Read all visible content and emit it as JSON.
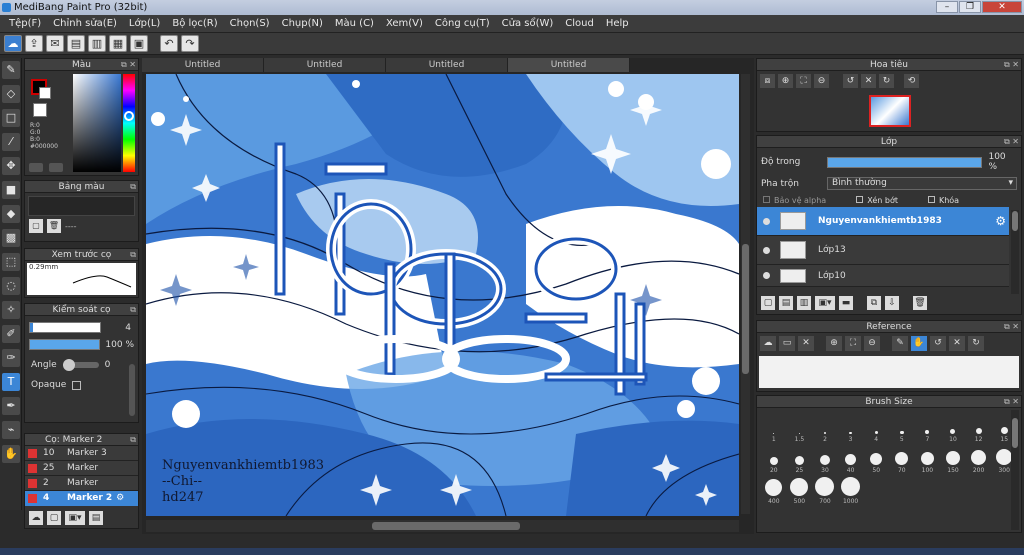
{
  "window": {
    "title": "MediBang Paint Pro (32bit)"
  },
  "menu": [
    "Tệp(F)",
    "Chỉnh sửa(E)",
    "Lớp(L)",
    "Bộ lọc(R)",
    "Chọn(S)",
    "Chụp(N)",
    "Màu (C)",
    "Xem(V)",
    "Công cụ(T)",
    "Cửa sổ(W)",
    "Cloud",
    "Help"
  ],
  "tabs": [
    "Untitled",
    "Untitled",
    "Untitled",
    "Untitled"
  ],
  "color_panel": {
    "title": "Màu",
    "r": "R:0",
    "g": "G:0",
    "b": "B:0",
    "hex": "#000000"
  },
  "palette_panel": {
    "title": "Bảng màu",
    "value": "----"
  },
  "preview_panel": {
    "title": "Xem trước cọ",
    "size": "0.29mm"
  },
  "control_panel": {
    "title": "Kiểm soát cọ",
    "size_value": "4",
    "opacity_value": "100 %",
    "angle_label": "Angle",
    "angle_value": "0",
    "opaque_label": "Opaque"
  },
  "brush_panel": {
    "title": "Cọ: Marker 2",
    "items": [
      {
        "size": "10",
        "name": "Marker 3"
      },
      {
        "size": "25",
        "name": "Marker"
      },
      {
        "size": "2",
        "name": "Marker"
      },
      {
        "size": "4",
        "name": "Marker 2"
      }
    ]
  },
  "navigator": {
    "title": "Hoa tiêu"
  },
  "layer_panel": {
    "title": "Lớp",
    "opacity_label": "Độ trong",
    "opacity_value": "100 %",
    "opacity_fraction": 1.0,
    "blend_label": "Pha trộn",
    "blend_value": "Bình thường",
    "protect_alpha": "Bảo vệ alpha",
    "clipping": "Xén bớt",
    "lock": "Khóa",
    "layers": [
      {
        "name": "Nguyenvankhiemtb1983",
        "selected": true
      },
      {
        "name": "Lớp13",
        "selected": false
      },
      {
        "name": "Lớp10",
        "selected": false
      }
    ]
  },
  "reference_panel": {
    "title": "Reference"
  },
  "brush_size_panel": {
    "title": "Brush Size",
    "sizes": [
      "1",
      "1.5",
      "2",
      "3",
      "4",
      "5",
      "7",
      "10",
      "12",
      "15",
      "20",
      "25",
      "30",
      "40",
      "50",
      "70",
      "100",
      "150",
      "200",
      "300",
      "400",
      "500",
      "700",
      "1000"
    ]
  },
  "canvas": {
    "watermark_lines": [
      "Nguyenvankhiemtb1983",
      "--Chi--",
      "hd247"
    ]
  },
  "colors": {
    "accent": "#3c86d6",
    "canvas_blue": "#3a78cf",
    "light_blue": "#9ec6f0",
    "fg_color": "#000000"
  }
}
